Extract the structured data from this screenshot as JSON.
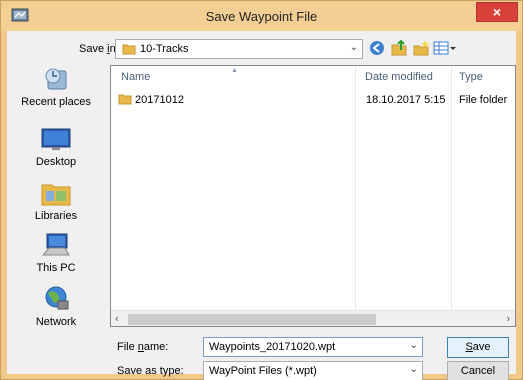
{
  "window": {
    "title": "Save Waypoint File",
    "close_label": "×"
  },
  "save_in": {
    "label_pre": "Save ",
    "label_key": "i",
    "label_post": "n:",
    "value": "10-Tracks"
  },
  "places": [
    {
      "label": "Recent places",
      "icon": "recent-places-icon"
    },
    {
      "label": "Desktop",
      "icon": "desktop-icon"
    },
    {
      "label": "Libraries",
      "icon": "libraries-icon"
    },
    {
      "label": "This PC",
      "icon": "this-pc-icon"
    },
    {
      "label": "Network",
      "icon": "network-icon"
    }
  ],
  "columns": {
    "name": "Name",
    "date": "Date modified",
    "type": "Type"
  },
  "files": [
    {
      "name": "20171012",
      "date": "18.10.2017 5:15",
      "type": "File folder"
    }
  ],
  "file_name": {
    "label_pre": "File ",
    "label_key": "n",
    "label_post": "ame:",
    "value": "Waypoints_20171020.wpt"
  },
  "save_type": {
    "label": "Save as type:",
    "value": "WayPoint Files (*.wpt)"
  },
  "buttons": {
    "save_key": "S",
    "save_rest": "ave",
    "cancel": "Cancel"
  },
  "colors": {
    "titlebar": "#f3cf94",
    "close": "#d8403a",
    "folder": "#e8b94a"
  }
}
